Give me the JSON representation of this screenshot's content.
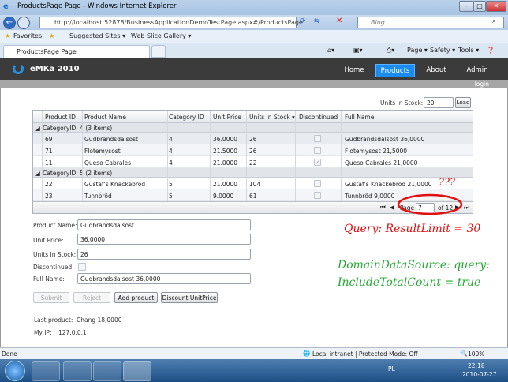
{
  "window": {
    "title": "ProductsPage Page - Windows Internet Explorer",
    "address": "http://localhost:52878/BusinessApplicationDemoTestPage.aspx#/ProductsPage",
    "search_placeholder": "Bing"
  },
  "favorites": {
    "label": "Favorites",
    "items": [
      "Suggested Sites ▾",
      "Web Slice Gallery ▾"
    ]
  },
  "tab": {
    "label": "ProductsPage Page"
  },
  "commandbar": [
    "Page ▾",
    "Safety ▾",
    "Tools ▾"
  ],
  "app": {
    "title": "eMKa 2010",
    "nav": [
      "Home",
      "Products",
      "About",
      "Admin"
    ],
    "active": "Products",
    "login": "login"
  },
  "filter": {
    "label": "Units In Stock:",
    "value": "20",
    "load": "Load"
  },
  "grid": {
    "columns": [
      "Product ID",
      "Product Name",
      "Category ID",
      "Unit Price",
      "Units In Stock ▾",
      "Discontinued",
      "Full Name"
    ],
    "groups": [
      {
        "label": "CategoryID: 4 (3 items)",
        "rows": [
          {
            "id": "69",
            "name": "Gudbrandsdalsost",
            "cat": "4",
            "price": "36.0000",
            "stock": "26",
            "disc": false,
            "full": "Gudbrandsdalsost 36,0000"
          },
          {
            "id": "71",
            "name": "Flotemysost",
            "cat": "4",
            "price": "21.5000",
            "stock": "26",
            "disc": false,
            "full": "Flotemysost 21,5000"
          },
          {
            "id": "11",
            "name": "Queso Cabrales",
            "cat": "4",
            "price": "21.0000",
            "stock": "22",
            "disc": true,
            "full": "Queso Cabrales 21,0000"
          }
        ]
      },
      {
        "label": "CategoryID: 5 (2 items)",
        "rows": [
          {
            "id": "22",
            "name": "Gustaf's Knäckebröd",
            "cat": "5",
            "price": "21.0000",
            "stock": "104",
            "disc": false,
            "full": "Gustaf's Knäckebröd 21,0000"
          },
          {
            "id": "23",
            "name": "Tunnbröd",
            "cat": "5",
            "price": "9.0000",
            "stock": "61",
            "disc": false,
            "full": "Tunnbröd 9,0000"
          }
        ]
      }
    ],
    "pager": {
      "page_label": "Page",
      "page": "7",
      "of": "of 12"
    }
  },
  "form": {
    "product_name_label": "Product Name:",
    "product_name": "Gudbrandsdalsost",
    "unit_price_label": "Unit Price:",
    "unit_price": "36.0000",
    "units_label": "Units In Stock:",
    "units": "26",
    "discontinued_label": "Discontinued:",
    "full_name_label": "Full Name:",
    "full_name": "Gudbrandsdalsost 36,0000"
  },
  "buttons": {
    "submit": "Submit",
    "reject": "Reject",
    "add": "Add product",
    "discount": "Discount UnitPrice"
  },
  "info": {
    "last_label": "Last product:",
    "last": "Chang 18,0000",
    "ip_label": "My IP:",
    "ip": "127.0.0.1"
  },
  "annotations": {
    "qmarks": "???",
    "query": "Query: ResultLimit = 30",
    "dds1": "DomainDataSource: query:",
    "dds2": "IncludeTotalCount = true"
  },
  "status": {
    "left": "Done",
    "zone": "Local intranet | Protected Mode: Off",
    "zoom": "100%"
  },
  "tray": {
    "lang": "PL",
    "time": "22:18",
    "date": "2010-07-27"
  }
}
